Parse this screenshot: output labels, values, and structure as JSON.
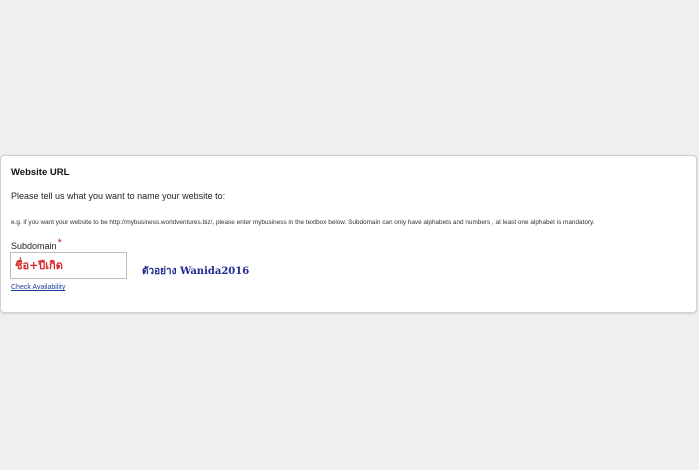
{
  "panel": {
    "title": "Website URL",
    "prompt": "Please tell us what you want to name your website to:",
    "hint": "e.g. if you want your website to be http://mybusiness.worldventures.biz/, please enter mybusiness in the textbox below. Subdomain can only have alphabets and numbers , at least one alphabet is mandatory.",
    "subdomain_label": "Subdomain",
    "required_mark": "*",
    "subdomain_value": "ชื่อ+ปีเกิด",
    "example_text": "ตัวอย่าง Wanida2016",
    "check_link": "Check Availability"
  },
  "colors": {
    "background": "#efefef",
    "panel": "#ffffff",
    "required": "#cc2222",
    "input_text": "#d42a2a",
    "example_text": "#1f2a8f",
    "link": "#1d3f9a"
  }
}
